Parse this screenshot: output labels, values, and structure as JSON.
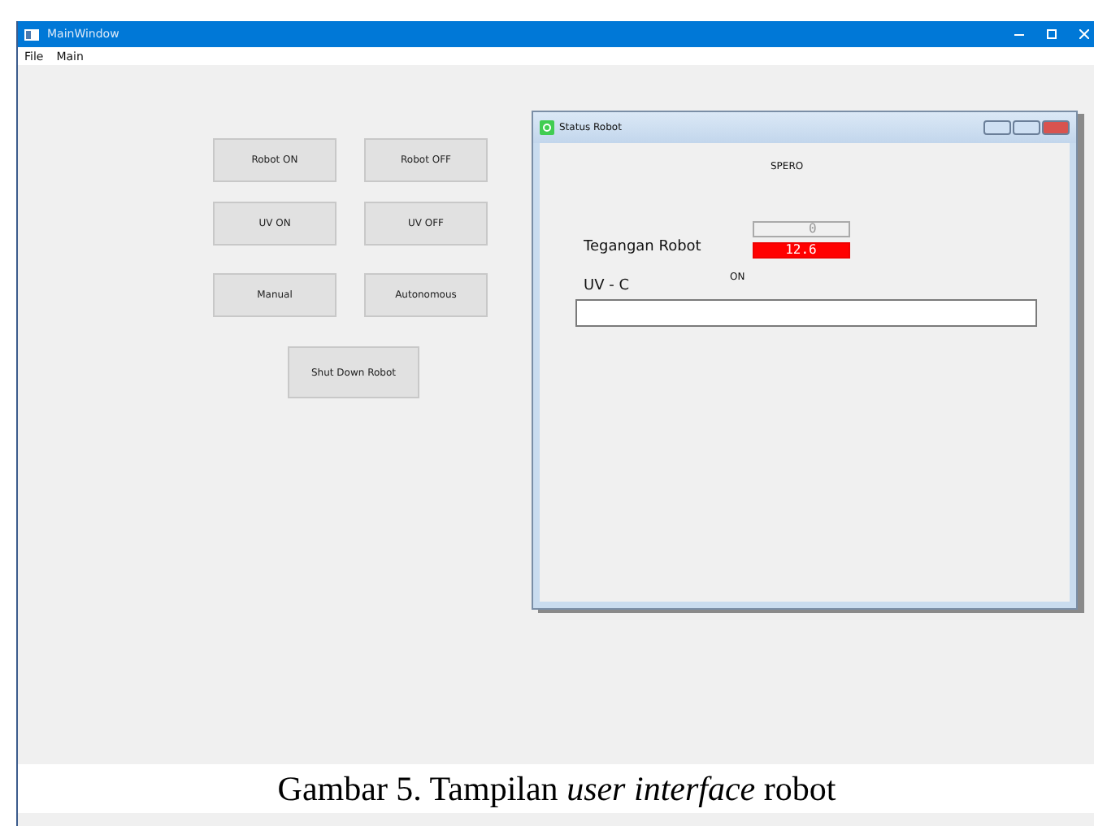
{
  "window": {
    "title": "MainWindow"
  },
  "menu": [
    {
      "label": "File"
    },
    {
      "label": "Main"
    }
  ],
  "buttons": [
    {
      "label": "Robot ON"
    },
    {
      "label": "Robot OFF"
    },
    {
      "label": "UV ON"
    },
    {
      "label": "UV OFF"
    },
    {
      "label": "Manual"
    },
    {
      "label": "Autonomous"
    }
  ],
  "shutdown_button": {
    "label": "Shut Down Robot"
  },
  "status_window": {
    "title": "Status Robot",
    "heading": "SPERO",
    "voltage_label": "Tegangan Robot",
    "lcd_top": {
      "value": "0",
      "alert": false
    },
    "lcd_bottom": {
      "value": "12.6",
      "alert": true
    },
    "uv_label": "UV - C",
    "uv_status": "ON"
  },
  "caption": "Gambar 5. Tampilan *user interface* robot"
}
